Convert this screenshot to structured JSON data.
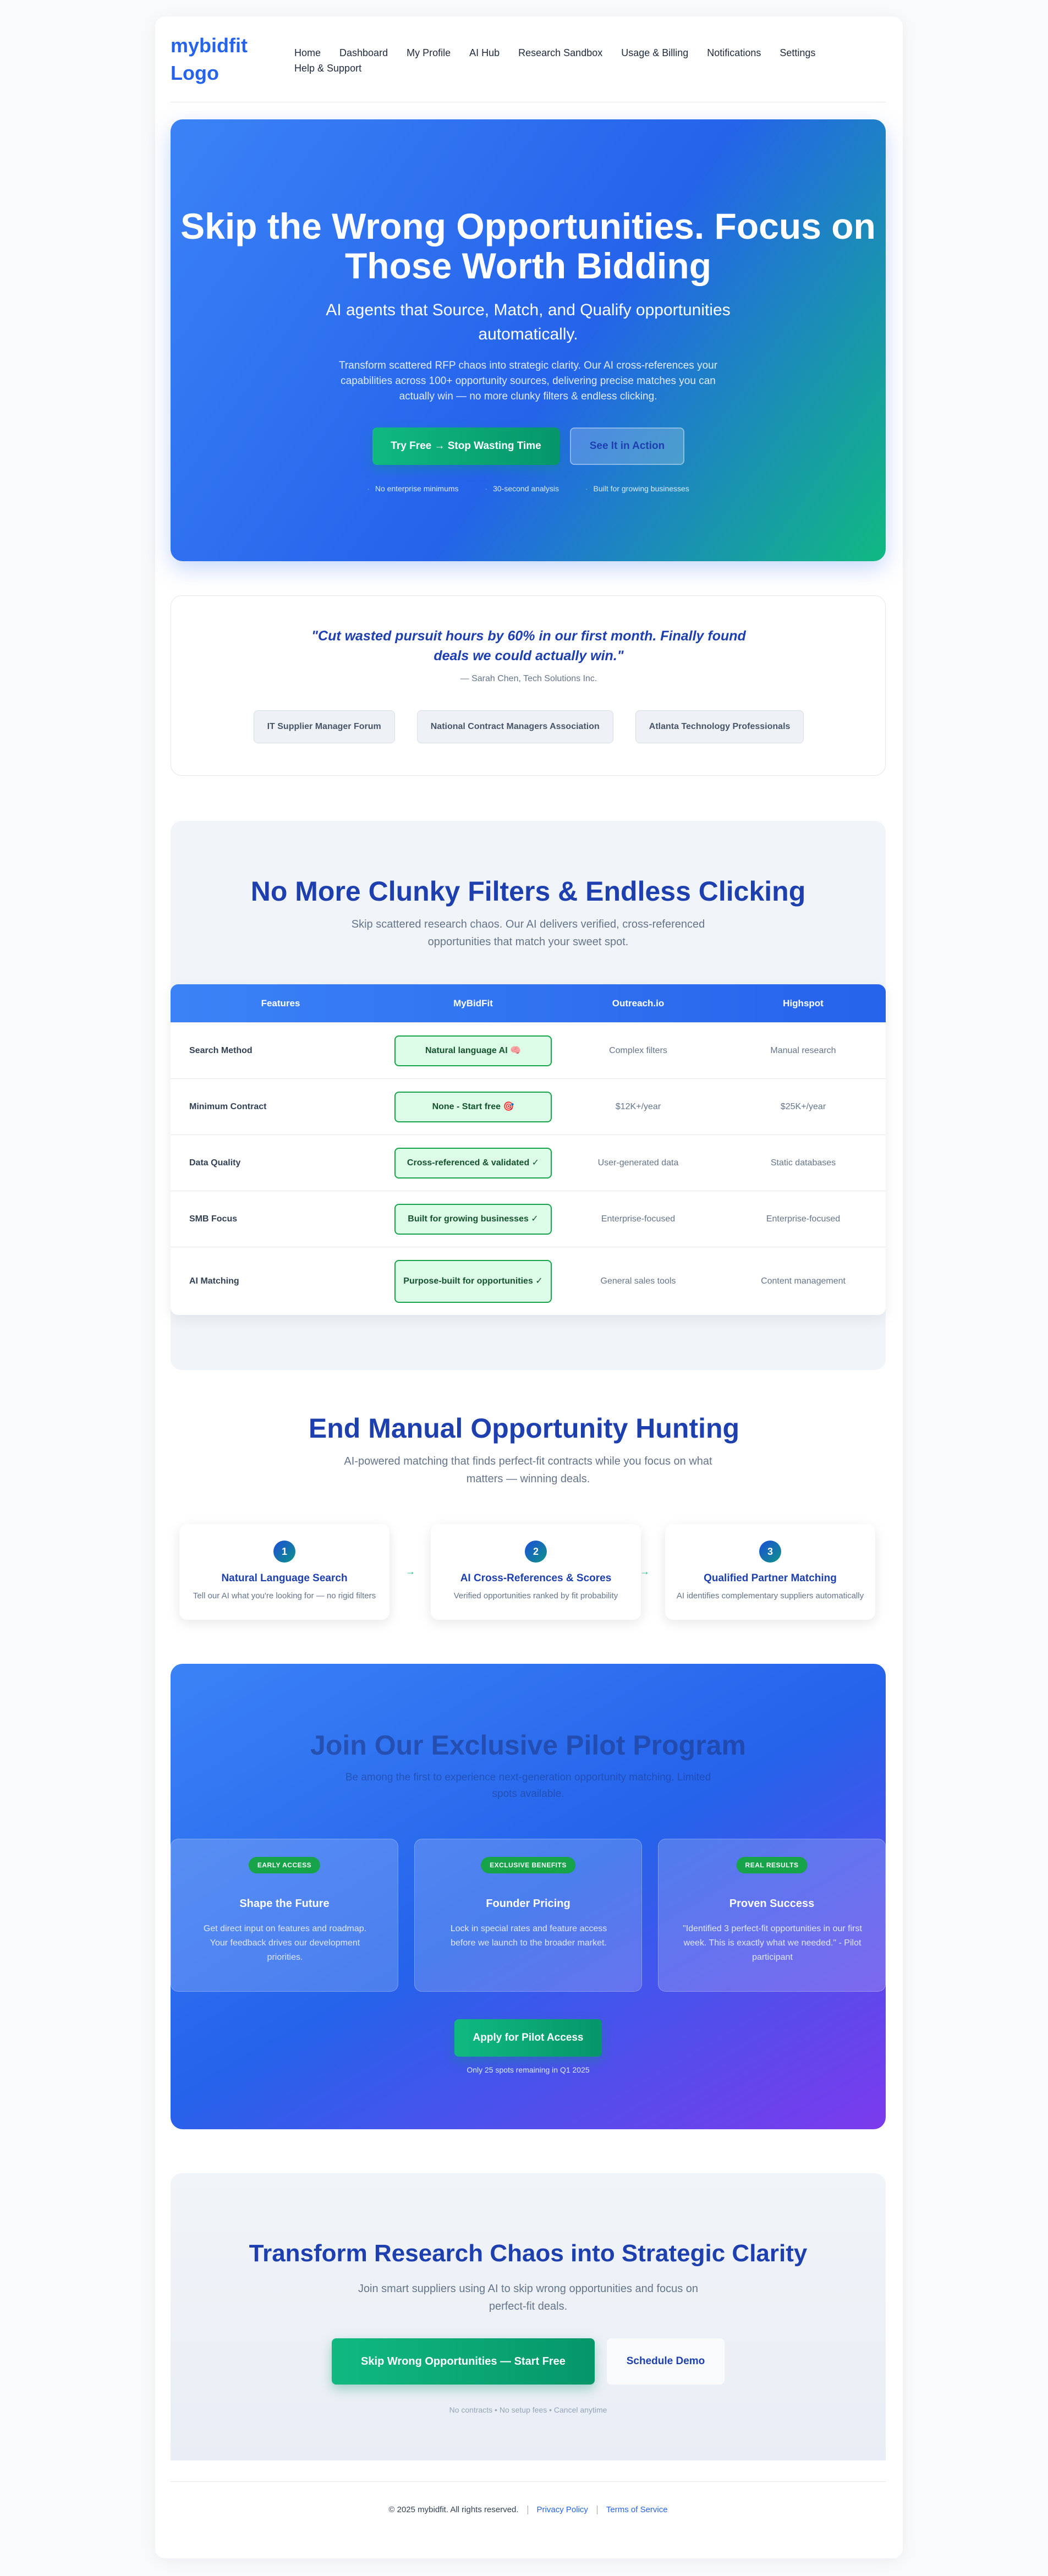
{
  "header": {
    "logo_alt": "mybidfit Logo",
    "nav": [
      "Home",
      "Dashboard",
      "My Profile",
      "AI Hub",
      "Research Sandbox",
      "Usage & Billing",
      "Notifications",
      "Settings",
      "Help & Support"
    ]
  },
  "hero": {
    "title": "Skip the Wrong Opportunities. Focus on Those Worth Bidding",
    "subtitle": "AI agents that Source, Match, and Qualify opportunities automatically.",
    "description": "Transform scattered RFP chaos into strategic clarity. Our AI cross-references your capabilities across 100+ opportunity sources, delivering precise matches you can actually win — no more clunky filters & endless clicking.",
    "cta_primary": "Try Free → Stop Wasting Time",
    "cta_secondary": "See It in Action",
    "points": [
      "No enterprise minimums",
      "30-second analysis",
      "Built for growing businesses"
    ]
  },
  "testimonial": {
    "quote": "\"Cut wasted pursuit hours by 60% in our first month. Finally found deals we could actually win.\"",
    "attribution": "— Sarah Chen, Tech Solutions Inc.",
    "badges": [
      "IT Supplier Manager Forum",
      "National Contract Managers Association",
      "Atlanta Technology Professionals"
    ]
  },
  "comparison": {
    "title": "No More Clunky Filters & Endless Clicking",
    "subtitle": "Skip scattered research chaos. Our AI delivers verified, cross-referenced opportunities that match your sweet spot.",
    "headers": [
      "Features",
      "MyBidFit",
      "Outreach.io",
      "Highspot"
    ],
    "rows": [
      {
        "feature": "Search Method",
        "mybidfit": "Natural language AI 🧠",
        "outreach": "Complex filters",
        "highspot": "Manual research"
      },
      {
        "feature": "Minimum Contract",
        "mybidfit": "None - Start free 🎯",
        "outreach": "$12K+/year",
        "highspot": "$25K+/year"
      },
      {
        "feature": "Data Quality",
        "mybidfit": "Cross-referenced & validated ✓",
        "outreach": "User-generated data",
        "highspot": "Static databases"
      },
      {
        "feature": "SMB Focus",
        "mybidfit": "Built for growing businesses ✓",
        "outreach": "Enterprise-focused",
        "highspot": "Enterprise-focused"
      },
      {
        "feature": "AI Matching",
        "mybidfit": "Purpose-built for opportunities ✓",
        "outreach": "General sales tools",
        "highspot": "Content management"
      }
    ]
  },
  "hunting": {
    "title": "End Manual Opportunity Hunting",
    "subtitle": "AI-powered matching that finds perfect-fit contracts while you focus on what matters — winning deals.",
    "steps": [
      {
        "num": "1",
        "title": "Natural Language Search",
        "desc": "Tell our AI what you're looking for — no rigid filters"
      },
      {
        "num": "2",
        "title": "AI Cross-References & Scores",
        "desc": "Verified opportunities ranked by fit probability"
      },
      {
        "num": "3",
        "title": "Qualified Partner Matching",
        "desc": "AI identifies complementary suppliers automatically"
      }
    ],
    "arrow": "→"
  },
  "pilot": {
    "title": "Join Our Exclusive Pilot Program",
    "subtitle": "Be among the first to experience next-generation opportunity matching. Limited spots available.",
    "cards": [
      {
        "tag": "EARLY ACCESS",
        "title": "Shape the Future",
        "desc": "Get direct input on features and roadmap. Your feedback drives our development priorities."
      },
      {
        "tag": "EXCLUSIVE BENEFITS",
        "title": "Founder Pricing",
        "desc": "Lock in special rates and feature access before we launch to the broader market."
      },
      {
        "tag": "REAL RESULTS",
        "title": "Proven Success",
        "desc": "\"Identified 3 perfect-fit opportunities in our first week. This is exactly what we needed.\" - Pilot participant"
      }
    ],
    "cta": "Apply for Pilot Access",
    "note": "Only 25 spots remaining in Q1 2025"
  },
  "final": {
    "title": "Transform Research Chaos into Strategic Clarity",
    "subtitle": "Join smart suppliers using AI to skip wrong opportunities and focus on perfect-fit deals.",
    "cta_primary": "Skip Wrong Opportunities — Start Free",
    "cta_secondary": "Schedule Demo",
    "note": "No contracts • No setup fees • Cancel anytime"
  },
  "footer": {
    "copyright": "© 2025 mybidfit. All rights reserved.",
    "privacy": "Privacy Policy",
    "terms": "Terms of Service"
  },
  "colors": {
    "brand_blue": "#2563eb",
    "accent_green": "#10b981",
    "heading_navy": "#1e40af"
  }
}
